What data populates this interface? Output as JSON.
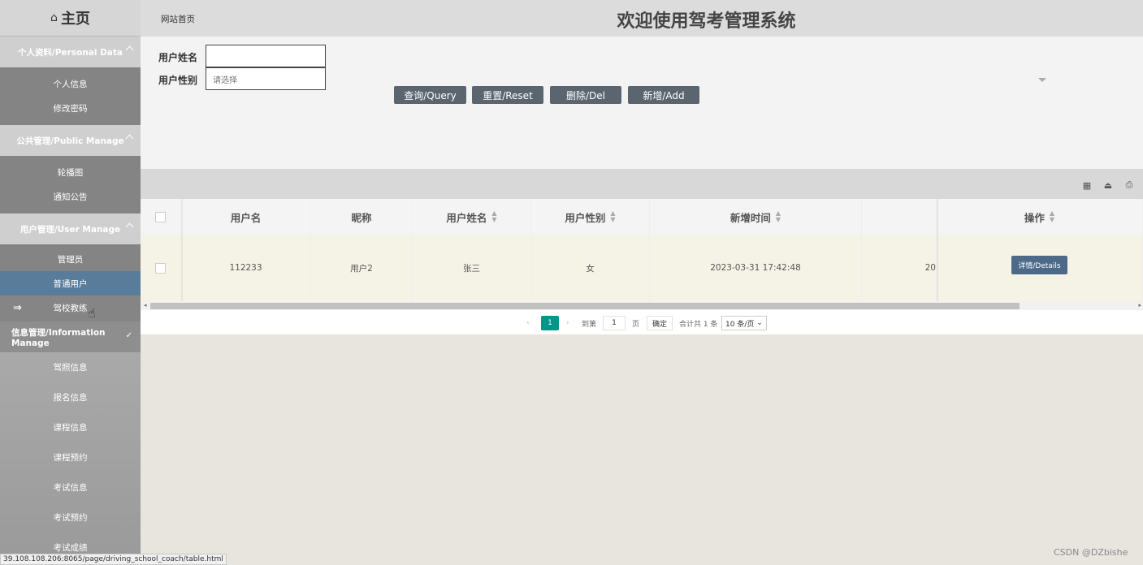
{
  "sidebar": {
    "home": "主页",
    "groups": {
      "personal": "个人资料/Personal Data",
      "public": "公共管理/Public Manage",
      "user": "用户管理/User Manage",
      "info": "信息管理/Information Manage"
    },
    "personal_items": [
      "个人信息",
      "修改密码"
    ],
    "public_items": [
      "轮播图",
      "通知公告"
    ],
    "user_items": [
      "管理员",
      "普通用户",
      "驾校教练"
    ],
    "info_items": [
      "驾照信息",
      "报名信息",
      "课程信息",
      "课程预约",
      "考试信息",
      "考试预约",
      "考试成绩"
    ]
  },
  "header": {
    "site_home": "网站首页",
    "title": "欢迎使用驾考管理系统"
  },
  "search": {
    "name_label": "用户姓名",
    "name_value": "",
    "gender_label": "用户性别",
    "gender_placeholder": "请选择",
    "query": "查询/Query",
    "reset": "重置/Reset",
    "delete": "删除/Del",
    "add": "新增/Add"
  },
  "table": {
    "columns": [
      "用户名",
      "昵称",
      "用户姓名",
      "用户性别",
      "新增时间",
      "操作"
    ],
    "rows": [
      {
        "username": "112233",
        "nickname": "用户2",
        "realname": "张三",
        "gender": "女",
        "created": "2023-03-31 17:42:48",
        "partial": "20",
        "action": "详情/Details"
      }
    ]
  },
  "pager": {
    "current": "1",
    "goto_label": "到第",
    "goto_value": "1",
    "page_unit": "页",
    "confirm": "确定",
    "total": "合计共 1 条",
    "page_size": "10 条/页"
  },
  "status_url": "39.108.108.206:8065/page/driving_school_coach/table.html",
  "watermark": "CSDN @DZbishe",
  "colors": {
    "active_item": "#597c9b",
    "button": "#5a6570",
    "pager_current": "#009688",
    "details_button": "#4c6a88"
  }
}
